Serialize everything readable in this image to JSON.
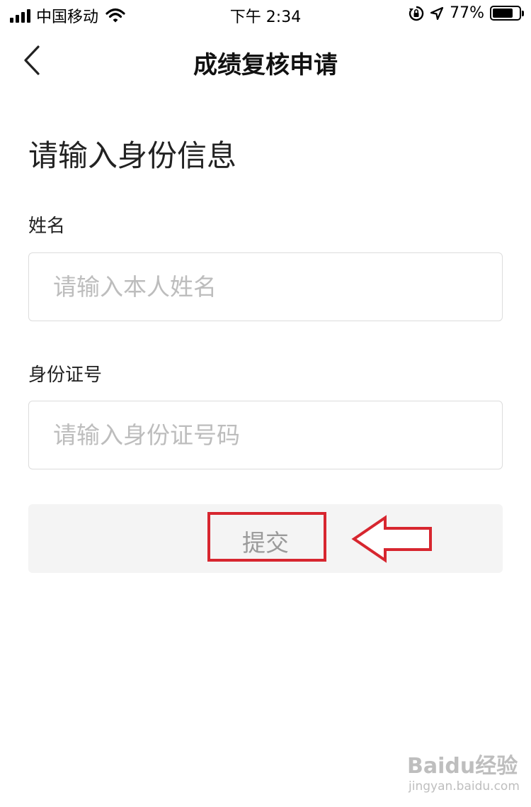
{
  "status_bar": {
    "carrier": "中国移动",
    "time": "下午 2:34",
    "battery_percent": "77%",
    "battery_level": 0.77,
    "icons": [
      "signal-icon",
      "wifi-icon",
      "rotation-lock-icon",
      "location-arrow-icon",
      "battery-icon"
    ]
  },
  "nav": {
    "title": "成绩复核申请",
    "back_icon": "chevron-left-icon"
  },
  "form": {
    "heading": "请输入身份信息",
    "name_label": "姓名",
    "name_placeholder": "请输入本人姓名",
    "id_label": "身份证号",
    "id_placeholder": "请输入身份证号码",
    "submit_label": "提交"
  },
  "annotation": {
    "highlight_color": "#d7262f",
    "arrow_icon": "left-arrow-outline-icon"
  },
  "watermark": {
    "brand": "Baidu经验",
    "url": "jingyan.baidu.com"
  }
}
